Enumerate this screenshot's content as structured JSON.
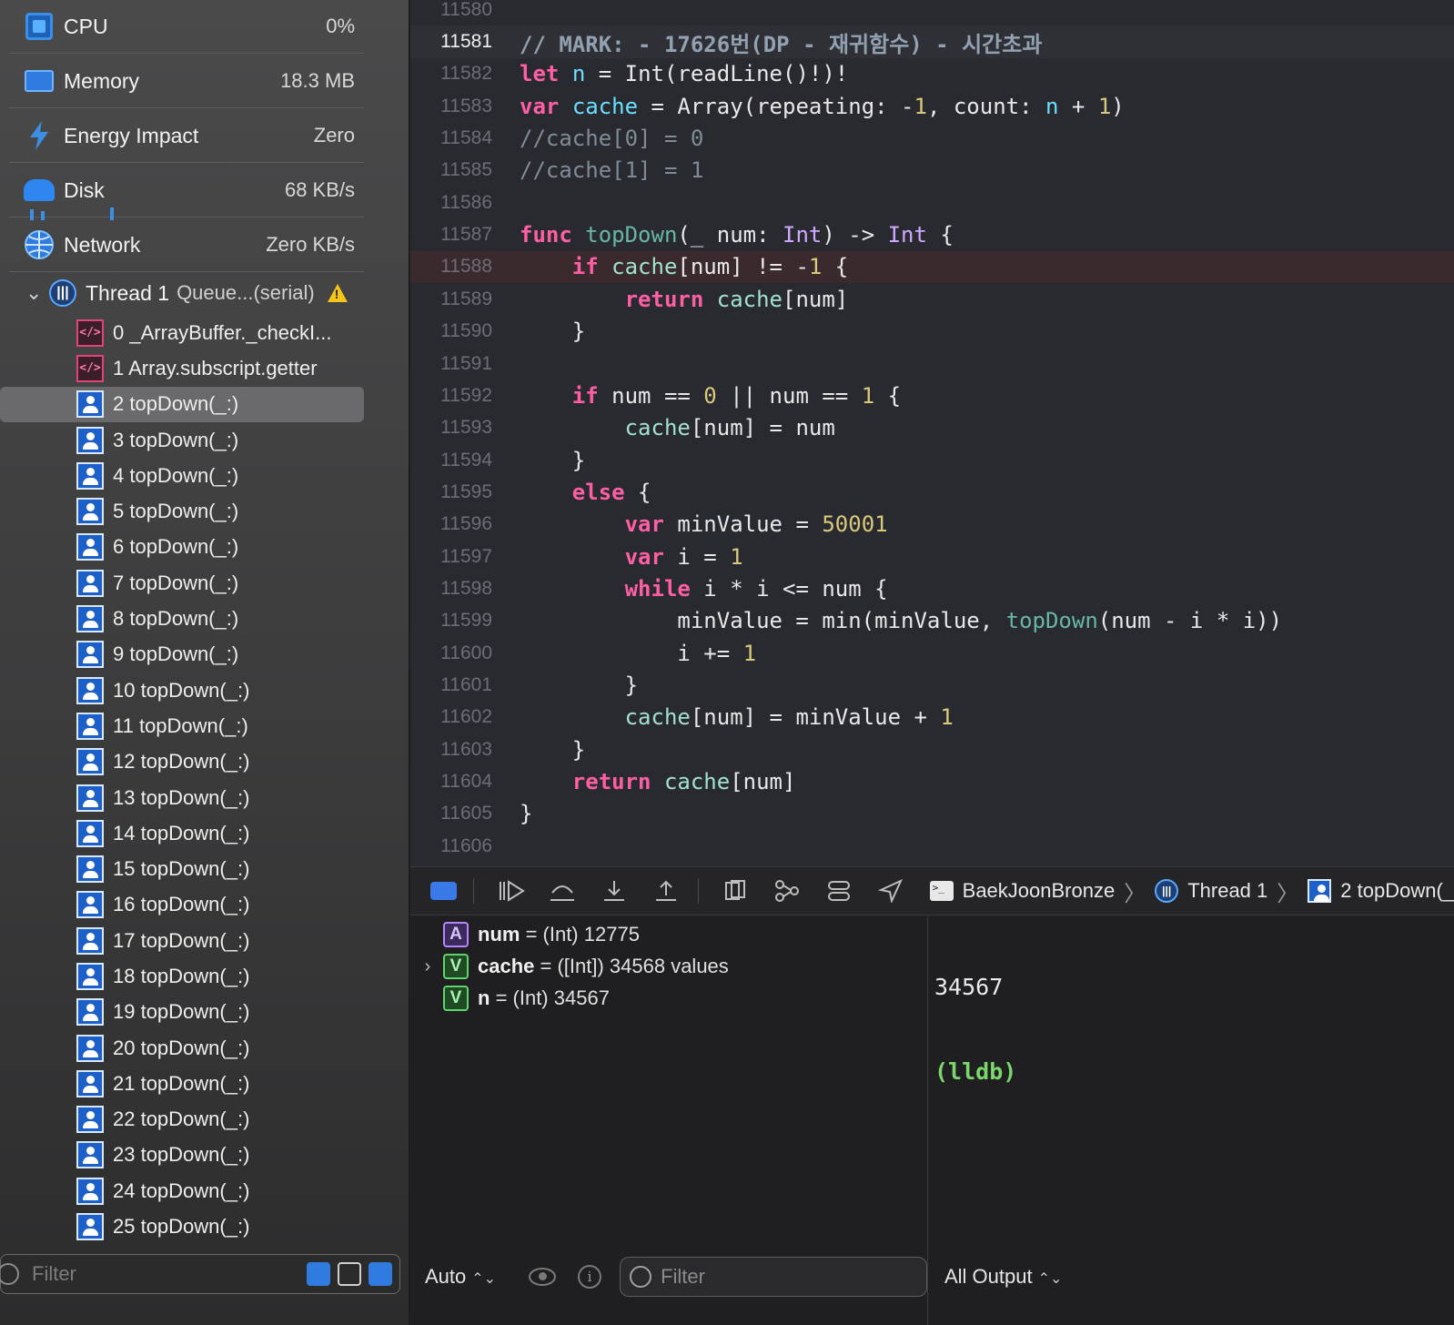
{
  "navigator": {
    "gauges": [
      {
        "label": "CPU",
        "value": "0%",
        "icon": "cpu-icon"
      },
      {
        "label": "Memory",
        "value": "18.3 MB",
        "icon": "memory-icon"
      },
      {
        "label": "Energy Impact",
        "value": "Zero",
        "icon": "energy-icon"
      },
      {
        "label": "Disk",
        "value": "68 KB/s",
        "icon": "disk-icon"
      },
      {
        "label": "Network",
        "value": "Zero KB/s",
        "icon": "network-icon"
      }
    ],
    "thread": {
      "name": "Thread 1",
      "queue": "Queue...(serial)",
      "chevron": "⌄",
      "glyph": "|||"
    },
    "frames": [
      "0 _ArrayBuffer._checkI...",
      "1 Array.subscript.getter",
      "2 topDown(_:)",
      "3 topDown(_:)",
      "4 topDown(_:)",
      "5 topDown(_:)",
      "6 topDown(_:)",
      "7 topDown(_:)",
      "8 topDown(_:)",
      "9 topDown(_:)",
      "10 topDown(_:)",
      "11 topDown(_:)",
      "12 topDown(_:)",
      "13 topDown(_:)",
      "14 topDown(_:)",
      "15 topDown(_:)",
      "16 topDown(_:)",
      "17 topDown(_:)",
      "18 topDown(_:)",
      "19 topDown(_:)",
      "20 topDown(_:)",
      "21 topDown(_:)",
      "22 topDown(_:)",
      "23 topDown(_:)",
      "24 topDown(_:)",
      "25 topDown(_:)"
    ],
    "selected_frame": 2,
    "filter_placeholder": "Filter"
  },
  "editor": {
    "current_line": "11581",
    "highlight_line": "11588",
    "lines": [
      {
        "n": "11580",
        "src": ""
      },
      {
        "n": "11581",
        "src": "<span class='mark'>// MARK: - 17626번(DP - 재귀함수) - 시간초과</span>"
      },
      {
        "n": "11582",
        "src": "<span class='kw'>let</span> <span class='var'>n</span> = Int(readLine()!)!"
      },
      {
        "n": "11583",
        "src": "<span class='kw'>var</span> <span class='var'>cache</span> = Array(repeating: -<span class='num'>1</span>, count: <span class='var'>n</span> + <span class='num'>1</span>)"
      },
      {
        "n": "11584",
        "src": "<span class='cmt'>//cache[0] = 0</span>"
      },
      {
        "n": "11585",
        "src": "<span class='cmt'>//cache[1] = 1</span>"
      },
      {
        "n": "11586",
        "src": ""
      },
      {
        "n": "11587",
        "src": "<span class='kw'>func</span> <span class='fn'>topDown</span>(_ num: <span class='typ'>Int</span>) -> <span class='typ'>Int</span> {"
      },
      {
        "n": "11588",
        "src": "    <span class='kw'>if</span> <span class='prop'>cache</span>[num] != -<span class='num'>1</span> {"
      },
      {
        "n": "11589",
        "src": "        <span class='kw'>return</span> <span class='prop'>cache</span>[num]"
      },
      {
        "n": "11590",
        "src": "    }"
      },
      {
        "n": "11591",
        "src": ""
      },
      {
        "n": "11592",
        "src": "    <span class='kw'>if</span> num == <span class='num'>0</span> || num == <span class='num'>1</span> {"
      },
      {
        "n": "11593",
        "src": "        <span class='prop'>cache</span>[num] = num"
      },
      {
        "n": "11594",
        "src": "    }"
      },
      {
        "n": "11595",
        "src": "    <span class='kw'>else</span> {"
      },
      {
        "n": "11596",
        "src": "        <span class='kw'>var</span> minValue = <span class='num'>50001</span>"
      },
      {
        "n": "11597",
        "src": "        <span class='kw'>var</span> i = <span class='num'>1</span>"
      },
      {
        "n": "11598",
        "src": "        <span class='kw'>while</span> i * i <= num {"
      },
      {
        "n": "11599",
        "src": "            minValue = min(minValue, <span class='fn'>topDown</span>(num - i * i))"
      },
      {
        "n": "11600",
        "src": "            i += <span class='num'>1</span>"
      },
      {
        "n": "11601",
        "src": "        }"
      },
      {
        "n": "11602",
        "src": "        <span class='prop'>cache</span>[num] = minValue + <span class='num'>1</span>"
      },
      {
        "n": "11603",
        "src": "    }"
      },
      {
        "n": "11604",
        "src": "    <span class='kw'>return</span> <span class='prop'>cache</span>[num]"
      },
      {
        "n": "11605",
        "src": "}"
      },
      {
        "n": "11606",
        "src": ""
      }
    ]
  },
  "debugbar": {
    "breadcrumbs": [
      "BaekJoonBronze",
      "Thread 1",
      "2 topDown(_"
    ],
    "crumb_sep": "〉"
  },
  "variables": [
    {
      "badge": "A",
      "name": "num",
      "rest": " = (Int) 12775",
      "expandable": false
    },
    {
      "badge": "V",
      "name": "cache",
      "rest": " = ([Int]) 34568 values",
      "expandable": true
    },
    {
      "badge": "V",
      "name": "n",
      "rest": " = (Int) 34567",
      "expandable": false
    }
  ],
  "variables_chevron": "›",
  "console": {
    "output": "34567",
    "prompt": "(lldb)"
  },
  "bottom": {
    "auto_label": "Auto",
    "updown": "⌃⌄",
    "filter_placeholder": "Filter",
    "output_label": "All Output",
    "info_glyph": "i"
  },
  "colors": {
    "accent": "#3a7ae8",
    "keyword": "#fc5fa3",
    "prompt": "#7bd66c"
  }
}
